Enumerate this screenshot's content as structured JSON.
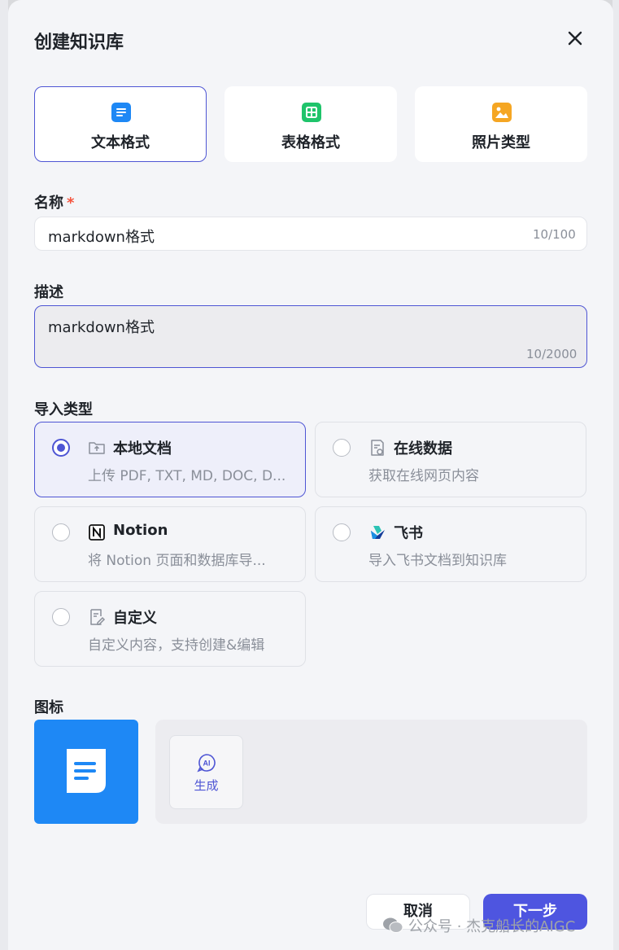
{
  "dialog": {
    "title": "创建知识库"
  },
  "format_tabs": [
    {
      "label": "文本格式",
      "icon": "text-doc-icon",
      "active": true
    },
    {
      "label": "表格格式",
      "icon": "table-icon",
      "active": false
    },
    {
      "label": "照片类型",
      "icon": "image-icon",
      "active": false
    }
  ],
  "name_field": {
    "label": "名称",
    "required_mark": "*",
    "value": "markdown格式",
    "counter": "10/100"
  },
  "desc_field": {
    "label": "描述",
    "value": "markdown格式",
    "counter": "10/2000"
  },
  "import_type": {
    "label": "导入类型",
    "options": [
      {
        "title": "本地文档",
        "desc": "上传 PDF, TXT, MD, DOC, D...",
        "icon": "folder-upload-icon",
        "selected": true
      },
      {
        "title": "在线数据",
        "desc": "获取在线网页内容",
        "icon": "web-doc-icon",
        "selected": false
      },
      {
        "title": "Notion",
        "desc": "将 Notion 页面和数据库导...",
        "icon": "notion-icon",
        "selected": false
      },
      {
        "title": "飞书",
        "desc": "导入飞书文档到知识库",
        "icon": "feishu-icon",
        "selected": false
      },
      {
        "title": "自定义",
        "desc": "自定义内容，支持创建&编辑",
        "icon": "custom-edit-icon",
        "selected": false
      }
    ]
  },
  "icon_section": {
    "label": "图标",
    "ai_generate_label": "生成",
    "ai_badge": "AI"
  },
  "footer": {
    "cancel_label": "取消",
    "next_label": "下一步"
  },
  "watermark": {
    "text": "公众号 · 杰克船长的AIGC"
  },
  "colors": {
    "accent": "#4e55d4",
    "icon_blue": "#1e88f5",
    "required": "#f5533d"
  }
}
